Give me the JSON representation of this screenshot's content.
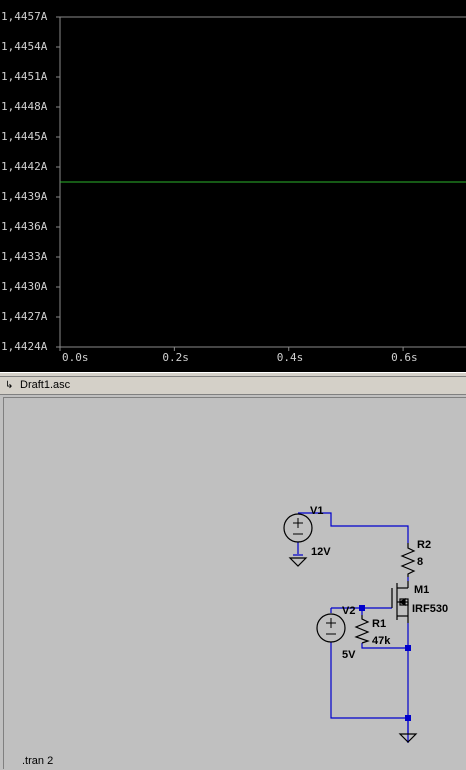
{
  "plot": {
    "y_ticks": [
      "1,4457A",
      "1,4454A",
      "1,4451A",
      "1,4448A",
      "1,4445A",
      "1,4442A",
      "1,4439A",
      "1,4436A",
      "1,4433A",
      "1,4430A",
      "1,4427A",
      "1,4424A"
    ],
    "x_ticks": [
      "0.0s",
      "0.2s",
      "0.4s",
      "0.6s"
    ],
    "trace_color": "#2bb52b",
    "grid_color": "#8a8a8a"
  },
  "chart_data": {
    "type": "line",
    "xlabel": "",
    "ylabel": "",
    "title": "",
    "xlim": [
      0.0,
      0.71
    ],
    "ylim": [
      1.4424,
      1.4457
    ],
    "series": [
      {
        "x": [
          0.0,
          0.71
        ],
        "y": [
          1.44405,
          1.44405
        ],
        "color": "#2bb52b"
      }
    ]
  },
  "schematic_window": {
    "title": "Draft1.asc",
    "icon": "schematic-doc-icon"
  },
  "schematic": {
    "wire_color": "#0000cc",
    "v1": {
      "name": "V1",
      "value": "12V"
    },
    "r2": {
      "name": "R2",
      "value": "8"
    },
    "m1": {
      "name": "M1",
      "value": "IRF530"
    },
    "v2": {
      "name": "V2",
      "value": "5V"
    },
    "r1": {
      "name": "R1",
      "value": "47k"
    },
    "directive": ".tran 2"
  }
}
